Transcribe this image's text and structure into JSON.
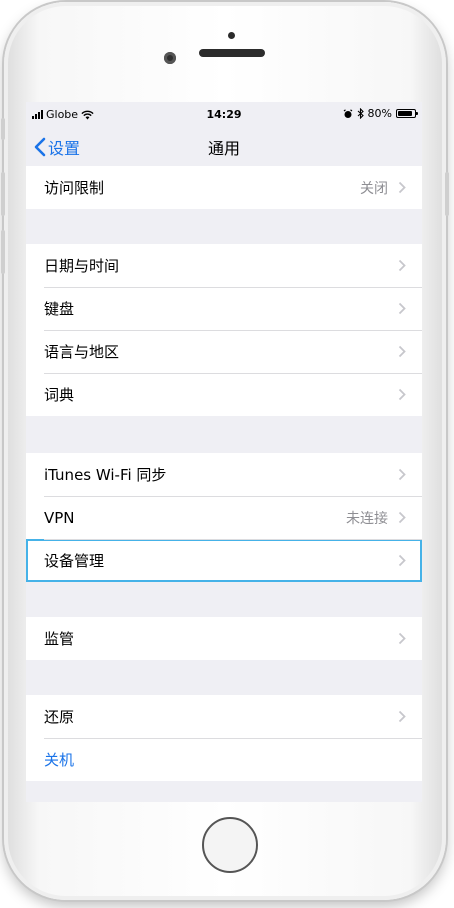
{
  "status_bar": {
    "carrier": "Globe",
    "time": "14:29",
    "battery": "80%"
  },
  "nav": {
    "back_label": "设置",
    "title": "通用"
  },
  "groups": [
    {
      "rows": [
        {
          "label": "访问限制",
          "detail": "关闭"
        }
      ]
    },
    {
      "rows": [
        {
          "label": "日期与时间"
        },
        {
          "label": "键盘"
        },
        {
          "label": "语言与地区"
        },
        {
          "label": "词典"
        }
      ]
    },
    {
      "rows": [
        {
          "label": "iTunes Wi-Fi 同步"
        },
        {
          "label": "VPN",
          "detail": "未连接"
        },
        {
          "label": "设备管理"
        }
      ]
    },
    {
      "rows": [
        {
          "label": "监管"
        }
      ]
    },
    {
      "rows": [
        {
          "label": "还原"
        },
        {
          "label": "关机"
        }
      ]
    }
  ],
  "colors": {
    "accent": "#1a73e8",
    "highlight": "#45b2e8",
    "background": "#efeff4"
  },
  "icons": [
    "signal-icon",
    "wifi-icon",
    "alarm-icon",
    "bluetooth-icon",
    "battery-icon",
    "back-chevron-icon",
    "chevron-right-icon",
    "home-button"
  ]
}
